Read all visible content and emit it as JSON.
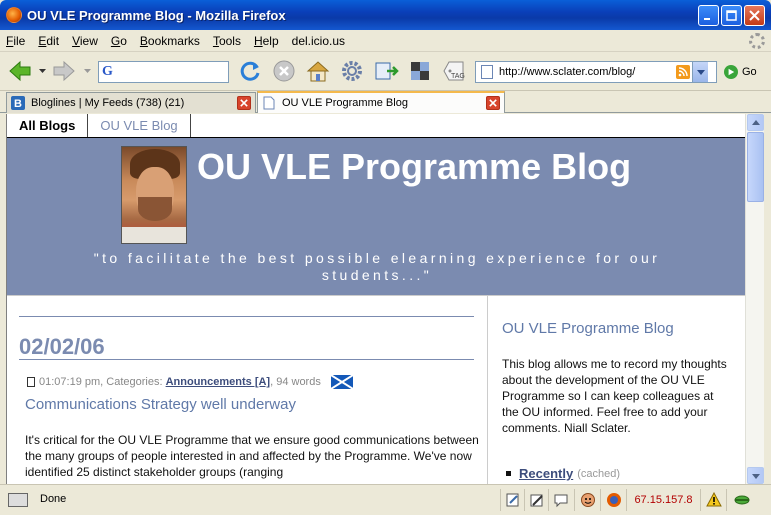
{
  "window": {
    "title": "OU VLE Programme Blog - Mozilla Firefox"
  },
  "menu": [
    "File",
    "Edit",
    "View",
    "Go",
    "Bookmarks",
    "Tools",
    "Help",
    "del.icio.us"
  ],
  "menu_accesskeys": [
    "F",
    "E",
    "V",
    "G",
    "B",
    "T",
    "H",
    ""
  ],
  "toolbar": {
    "search_value": "",
    "url": "http://www.sclater.com/blog/",
    "go_label": "Go",
    "tag_label": "TAG"
  },
  "tabs": [
    {
      "label": "Bloglines | My Feeds (738) (21)",
      "active": false
    },
    {
      "label": "OU VLE Programme Blog",
      "active": true
    }
  ],
  "page": {
    "nav": [
      "All Blogs",
      "OU VLE Blog"
    ],
    "blog_title": "OU VLE Programme Blog",
    "tagline": "\"to facilitate the best possible elearning experience for our students...\"",
    "date": "02/02/06",
    "post": {
      "time": "01:07:19 pm, Categories:",
      "category": "Announcements [A]",
      "words": ", 94 words",
      "title": "Communications Strategy well underway",
      "body": "It's critical for the OU VLE Programme that we ensure good communications between the many groups of people interested in and affected by the Programme. We've now identified 25 distinct stakeholder groups (ranging"
    },
    "sidebar": {
      "title": "OU VLE Programme Blog",
      "text": "This blog allows me to record my thoughts about the development of the OU VLE Programme so I can keep colleagues at the OU informed. Feel free to add your comments. Niall Sclater.",
      "link": "Recently",
      "link_note": "(cached)"
    }
  },
  "status": {
    "text": "Done",
    "ip": "67.15.157.8"
  },
  "colors": {
    "titlebar": "#0a3fb8",
    "header_bg": "#7b8bb0",
    "accent_text": "#6079a8",
    "ip_text": "#b30000"
  }
}
